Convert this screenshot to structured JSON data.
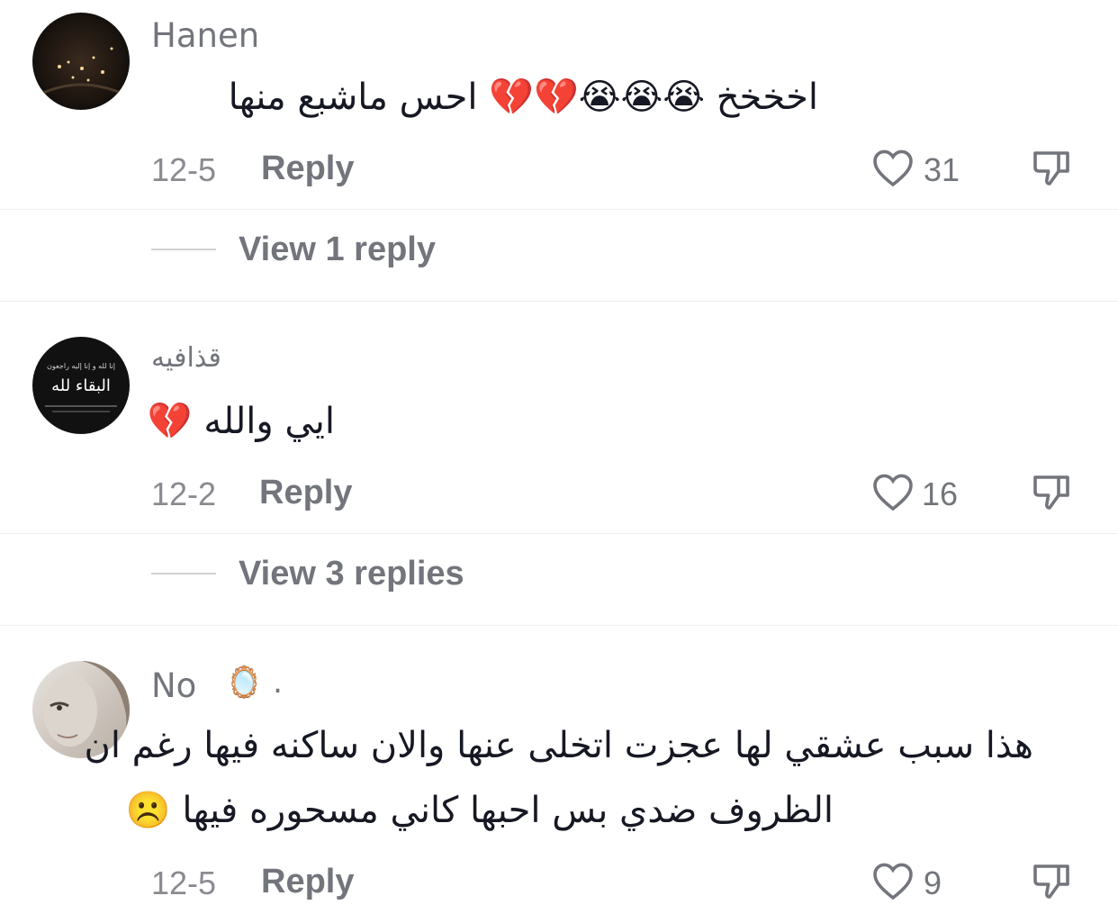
{
  "comments": [
    {
      "username": "Hanen",
      "text": "اخخخخ 😭😭😭💔💔 احس ماشبع منها",
      "date": "12-5",
      "reply_label": "Reply",
      "likes": "31",
      "view_replies": "View 1 reply"
    },
    {
      "username": "قذافيه",
      "avatar_text": "البقاء لله",
      "avatar_small_text": "إنا لله و إنا إليه راجعون",
      "text": "ايي والله 💔",
      "date": "12-2",
      "reply_label": "Reply",
      "likes": "16",
      "view_replies": "View 3 replies"
    },
    {
      "username": "No",
      "username_suffix": "🪞 .",
      "text_line1": "هذا سبب عشقي لها عجزت اتخلى عنها والان ساكنه فيها رغم ان",
      "text_line2": "الظروف ضدي بس احبها كاني مسحوره فيها ☹️",
      "date": "12-5",
      "reply_label": "Reply",
      "likes": "9"
    }
  ],
  "icons": {
    "like": "heart-outline-icon",
    "dislike": "thumbs-down-icon"
  },
  "colors": {
    "text": "#161823",
    "secondary": "#73757c",
    "muted": "#8a8b91"
  }
}
